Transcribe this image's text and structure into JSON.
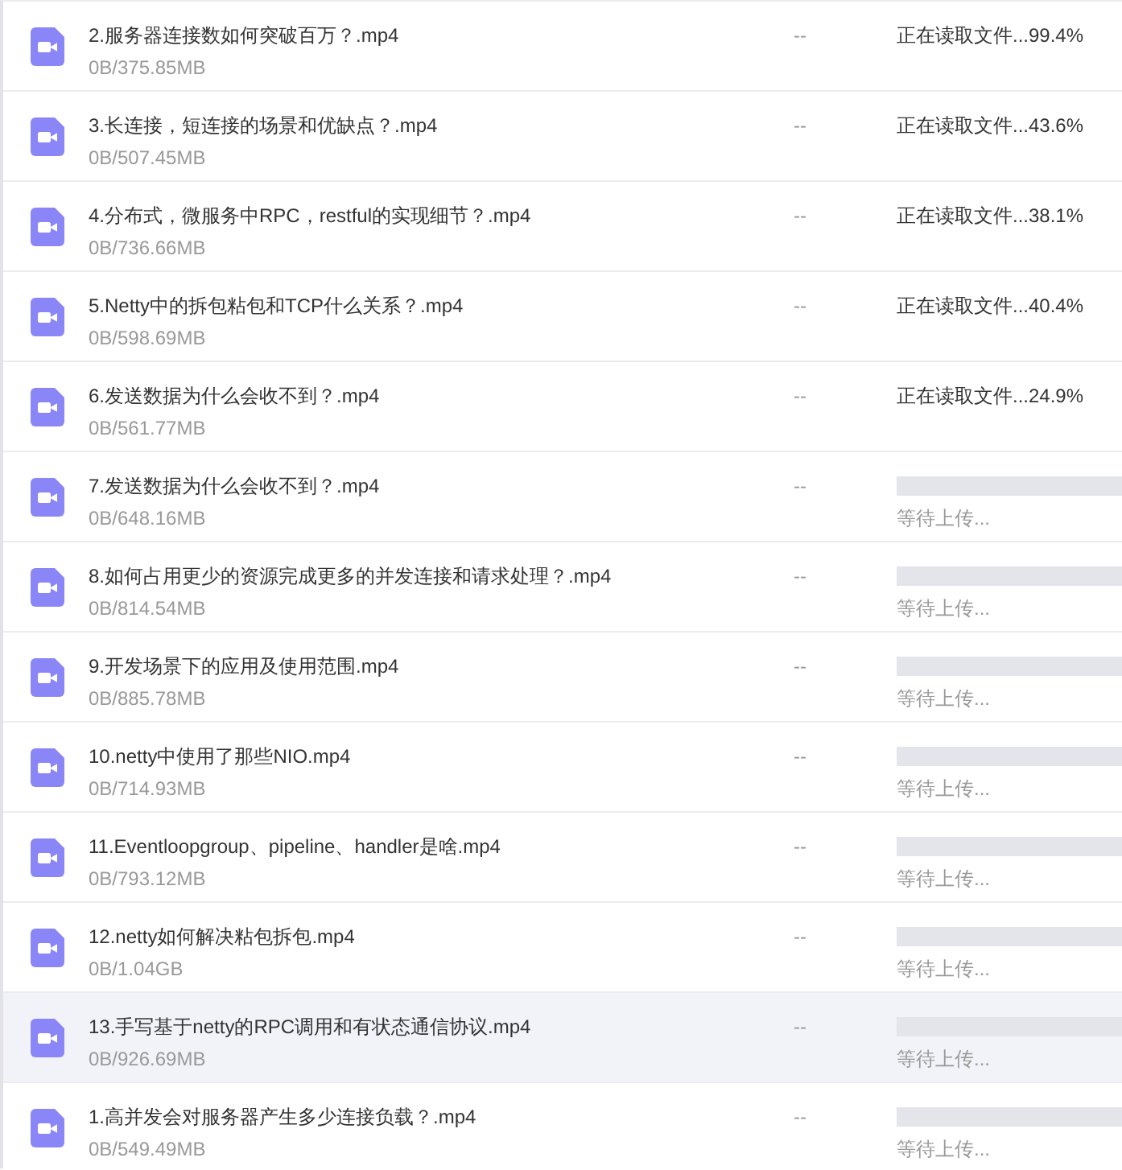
{
  "rows": [
    {
      "name": "2.服务器连接数如何突破百万？.mp4",
      "size": "0B/375.85MB",
      "column_3": "--",
      "kind": "reading",
      "status": "正在读取文件...99.4%",
      "selected": false
    },
    {
      "name": "3.长连接，短连接的场景和优缺点？.mp4",
      "size": "0B/507.45MB",
      "column_3": "--",
      "kind": "reading",
      "status": "正在读取文件...43.6%",
      "selected": false
    },
    {
      "name": "4.分布式，微服务中RPC，restful的实现细节？.mp4",
      "size": "0B/736.66MB",
      "column_3": "--",
      "kind": "reading",
      "status": "正在读取文件...38.1%",
      "selected": false
    },
    {
      "name": "5.Netty中的拆包粘包和TCP什么关系？.mp4",
      "size": "0B/598.69MB",
      "column_3": "--",
      "kind": "reading",
      "status": "正在读取文件...40.4%",
      "selected": false
    },
    {
      "name": "6.发送数据为什么会收不到？.mp4",
      "size": "0B/561.77MB",
      "column_3": "--",
      "kind": "reading",
      "status": "正在读取文件...24.9%",
      "selected": false
    },
    {
      "name": "7.发送数据为什么会收不到？.mp4",
      "size": "0B/648.16MB",
      "column_3": "--",
      "kind": "waiting",
      "status": "等待上传...",
      "selected": false
    },
    {
      "name": "8.如何占用更少的资源完成更多的并发连接和请求处理？.mp4",
      "size": "0B/814.54MB",
      "column_3": "--",
      "kind": "waiting",
      "status": "等待上传...",
      "selected": false
    },
    {
      "name": "9.开发场景下的应用及使用范围.mp4",
      "size": "0B/885.78MB",
      "column_3": "--",
      "kind": "waiting",
      "status": "等待上传...",
      "selected": false
    },
    {
      "name": "10.netty中使用了那些NIO.mp4",
      "size": "0B/714.93MB",
      "column_3": "--",
      "kind": "waiting",
      "status": "等待上传...",
      "selected": false
    },
    {
      "name": "11.Eventloopgroup、pipeline、handler是啥.mp4",
      "size": "0B/793.12MB",
      "column_3": "--",
      "kind": "waiting",
      "status": "等待上传...",
      "selected": false
    },
    {
      "name": "12.netty如何解决粘包拆包.mp4",
      "size": "0B/1.04GB",
      "column_3": "--",
      "kind": "waiting",
      "status": "等待上传...",
      "selected": false
    },
    {
      "name": "13.手写基于netty的RPC调用和有状态通信协议.mp4",
      "size": "0B/926.69MB",
      "column_3": "--",
      "kind": "waiting",
      "status": "等待上传...",
      "selected": true
    },
    {
      "name": "1.高并发会对服务器产生多少连接负载？.mp4",
      "size": "0B/549.49MB",
      "column_3": "--",
      "kind": "waiting",
      "status": "等待上传...",
      "selected": false
    }
  ]
}
